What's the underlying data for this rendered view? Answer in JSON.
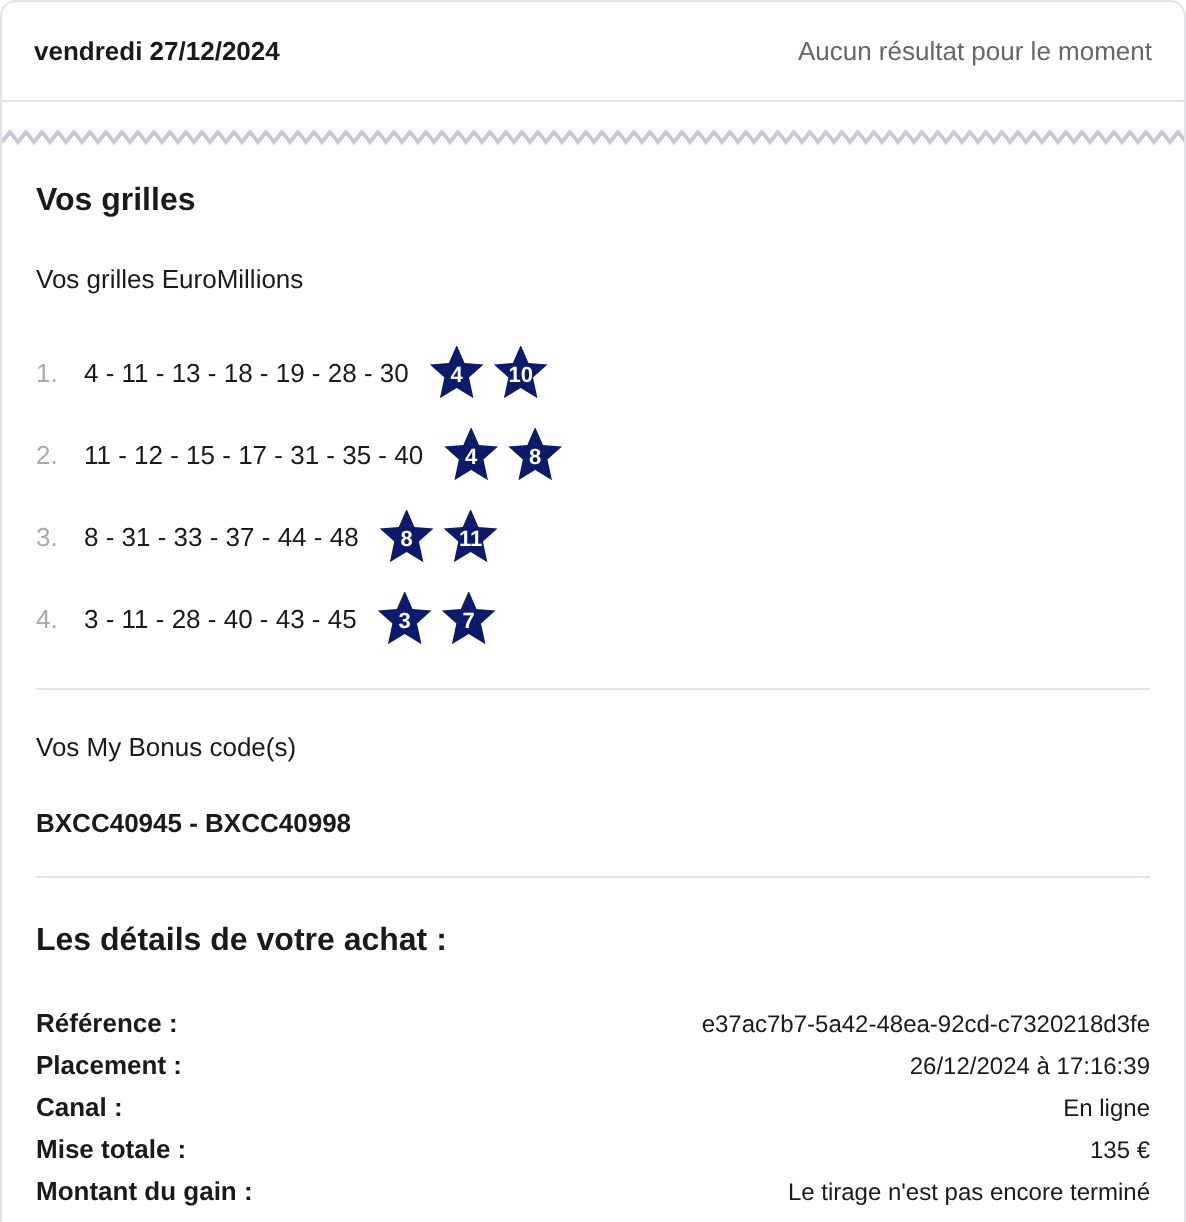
{
  "header": {
    "date": "vendredi 27/12/2024",
    "result_status": "Aucun résultat pour le moment"
  },
  "grids_section": {
    "title": "Vos grilles",
    "subtitle": "Vos grilles EuroMillions",
    "grids": [
      {
        "index": "1.",
        "numbers": "4 - 11 - 13 - 18 - 19 - 28 - 30",
        "stars": [
          "4",
          "10"
        ]
      },
      {
        "index": "2.",
        "numbers": "11 - 12 - 15 - 17 - 31 - 35 - 40",
        "stars": [
          "4",
          "8"
        ]
      },
      {
        "index": "3.",
        "numbers": "8 - 31 - 33 - 37 - 44 - 48",
        "stars": [
          "8",
          "11"
        ]
      },
      {
        "index": "4.",
        "numbers": "3 - 11 - 28 - 40 - 43 - 45",
        "stars": [
          "3",
          "7"
        ]
      }
    ]
  },
  "bonus": {
    "title": "Vos My Bonus code(s)",
    "codes": "BXCC40945 - BXCC40998"
  },
  "purchase_details": {
    "title": "Les détails de votre achat :",
    "rows": [
      {
        "label": "Référence :",
        "value": "e37ac7b7-5a42-48ea-92cd-c7320218d3fe"
      },
      {
        "label": "Placement :",
        "value": "26/12/2024 à 17:16:39"
      },
      {
        "label": "Canal :",
        "value": "En ligne"
      },
      {
        "label": "Mise totale :",
        "value": "135 €"
      },
      {
        "label": "Montant du gain :",
        "value": "Le tirage n'est pas encore terminé"
      }
    ]
  }
}
